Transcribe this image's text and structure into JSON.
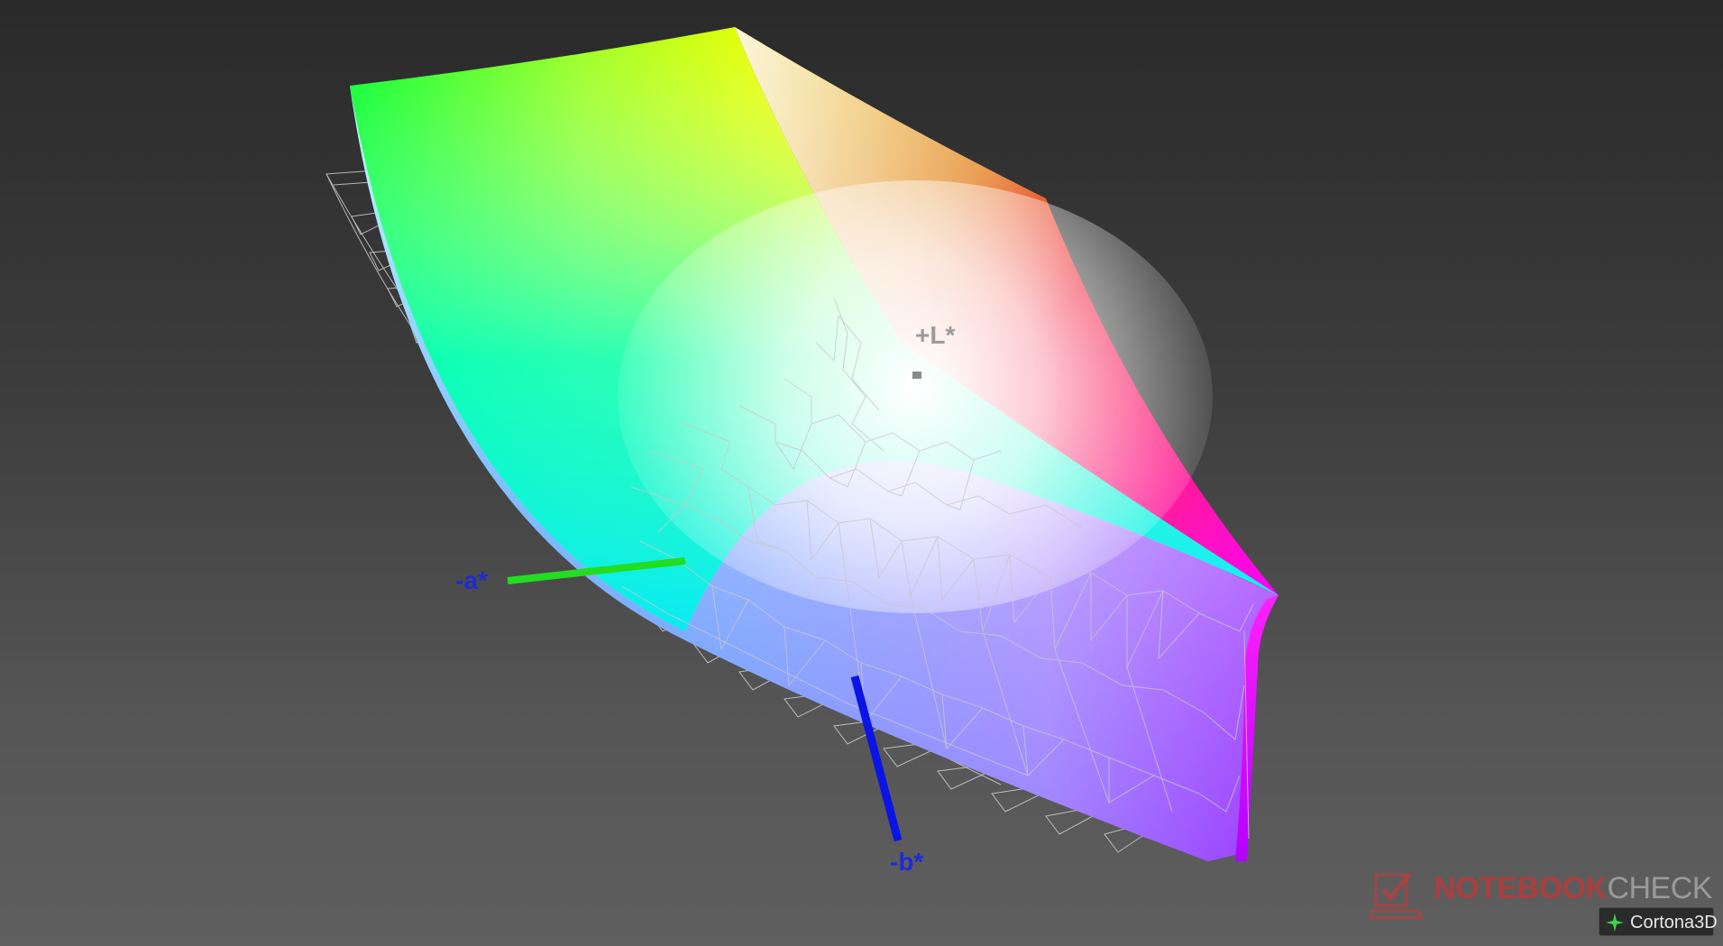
{
  "axes": {
    "a_label": "-a*",
    "b_label": "-b*",
    "l_label": "+L*",
    "a_color": "#22dd22",
    "b_color": "#0a14e6"
  },
  "watermark": {
    "brand_part1": "NOTEBOOK",
    "brand_part2": "CHECK",
    "viewer": "Cortona3D",
    "icon": "laptop-check-icon"
  },
  "colors": {
    "background_top": "#2a2a2a",
    "background_bottom": "#5f5f5f",
    "wireframe": "#cfcfcf"
  }
}
